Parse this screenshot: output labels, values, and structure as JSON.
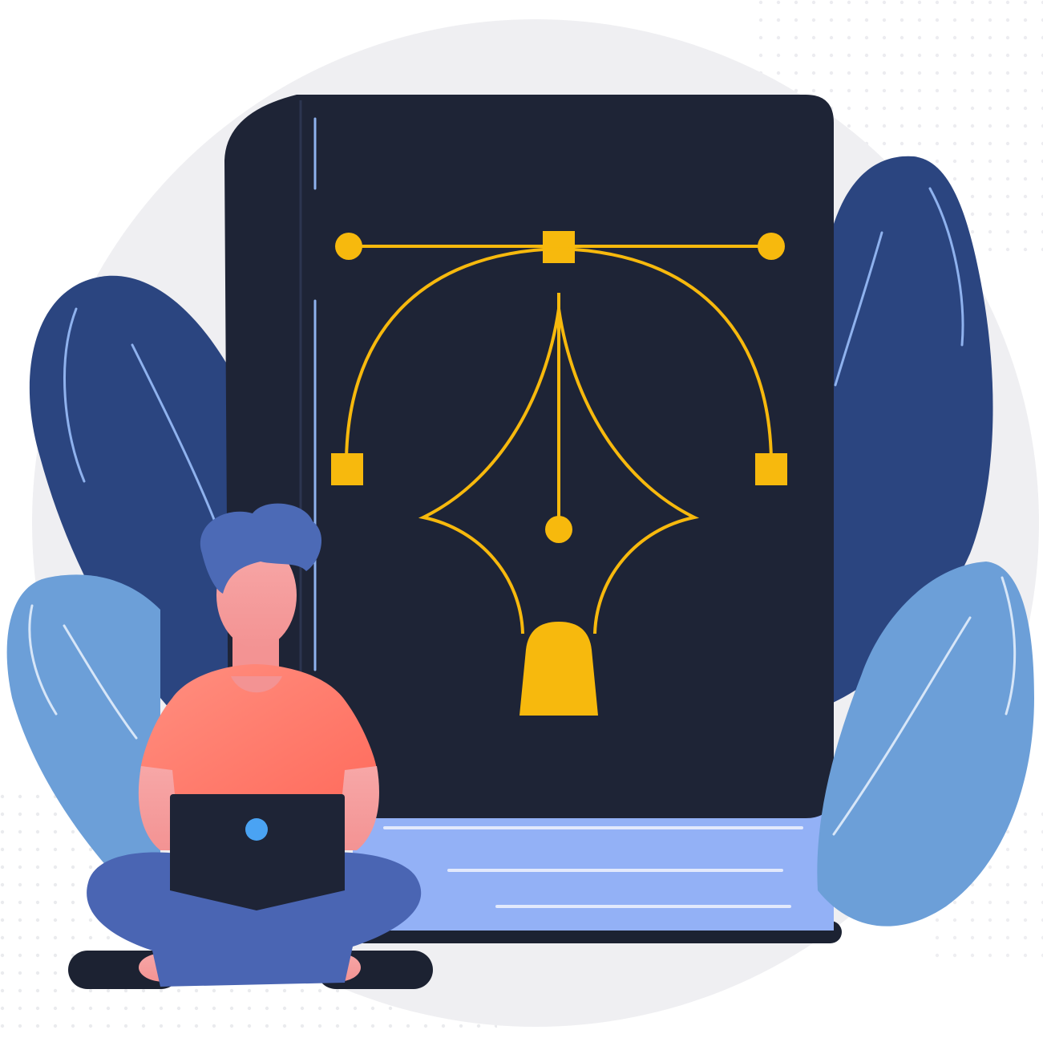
{
  "illustration": {
    "subject": "person-with-laptop-and-design-book",
    "colors": {
      "background_circle": "#efeff2",
      "dots": "#dcdde3",
      "book_cover": "#1e2436",
      "book_pages": "#93b1f6",
      "book_page_lines": "#e2e9fc",
      "book_base": "#1c2232",
      "pen_tool": "#f7b90d",
      "leaf_dark": "#2b4580",
      "leaf_light": "#6c9fd8",
      "leaf_vein_dark": "#8fb2ee",
      "leaf_vein_light": "#d7e6f8",
      "skin": "#f5a0a0",
      "hair": "#4c6ab6",
      "shirt": "#ff7262",
      "pants": "#4a65b3",
      "shoes": "#1c2232",
      "laptop": "#1e2436",
      "laptop_logo": "#4aa3f3"
    }
  }
}
